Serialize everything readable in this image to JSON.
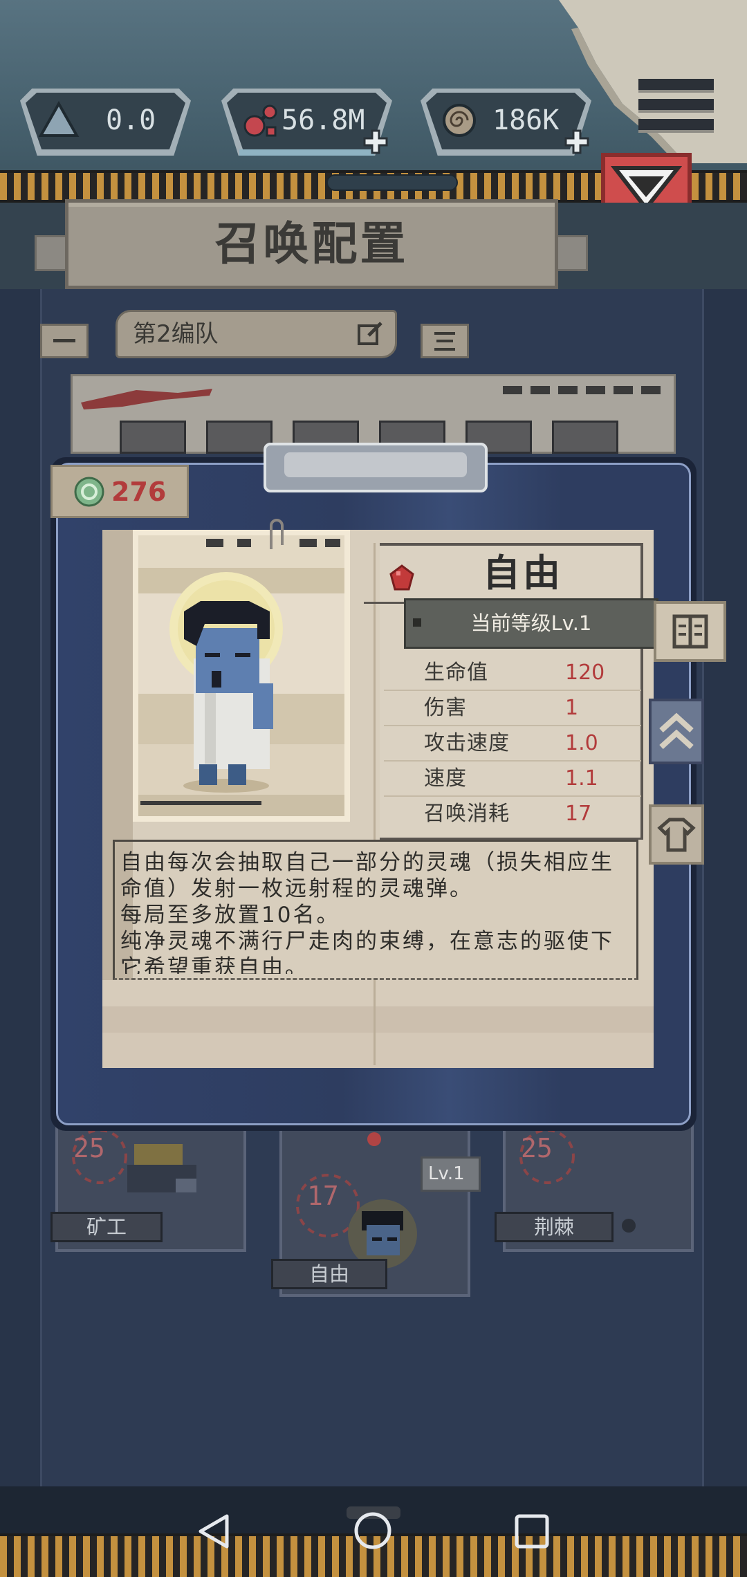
{
  "top_bar": {
    "resources": [
      {
        "icon": "triangle-crystal-icon",
        "value": "0.0"
      },
      {
        "icon": "molecule-icon",
        "value": "56.8M",
        "add_icon": "plus-icon"
      },
      {
        "icon": "shell-icon",
        "value": "186K",
        "add_icon": "plus-icon"
      }
    ],
    "menu_icon": "hamburger-menu-icon",
    "collapse_icon": "triangle-down-icon"
  },
  "header": {
    "title": "召唤配置"
  },
  "squad_bar": {
    "name": "第2编队",
    "prev_icon": "minus-icon",
    "edit_icon": "edit-icon",
    "list_icon": "list-icon"
  },
  "unit_detail": {
    "currency_icon": "green-token-icon",
    "currency": "276",
    "name": "自由",
    "rarity_icon": "red-gem-icon",
    "level_label": "当前等级Lv.1",
    "stats": [
      {
        "label": "生命值",
        "value": "120"
      },
      {
        "label": "伤害",
        "value": "1"
      },
      {
        "label": "攻击速度",
        "value": "1.0"
      },
      {
        "label": "速度",
        "value": "1.1"
      },
      {
        "label": "召唤消耗",
        "value": "17"
      }
    ],
    "description": [
      "自由每次会抽取自己一部分的灵魂（损失相应生",
      "命值）发射一枚远射程的灵魂弹。",
      "每局至多放置10名。",
      "纯净灵魂不满行尸走肉的束缚，在意志的驱使下",
      "它希望重获自由。"
    ],
    "side_buttons": [
      "book-icon",
      "upgrade-chevrons-icon",
      "shirt-icon"
    ]
  },
  "unit_cards": [
    {
      "name": "矿工",
      "cost": "25"
    },
    {
      "name": "自由",
      "cost": "17",
      "level": "Lv.1"
    },
    {
      "name": "荆棘",
      "cost": "25"
    }
  ],
  "system_nav": {
    "back_icon": "back-icon",
    "home_icon": "home-icon",
    "recents_icon": "recents-icon"
  },
  "colors": {
    "stat_value": "#b23b3b",
    "accent_red": "#cf4d4d",
    "hazard_stripe": "#c4913f",
    "modal_panel": "#2e3d60",
    "paper": "#d8cebd"
  }
}
